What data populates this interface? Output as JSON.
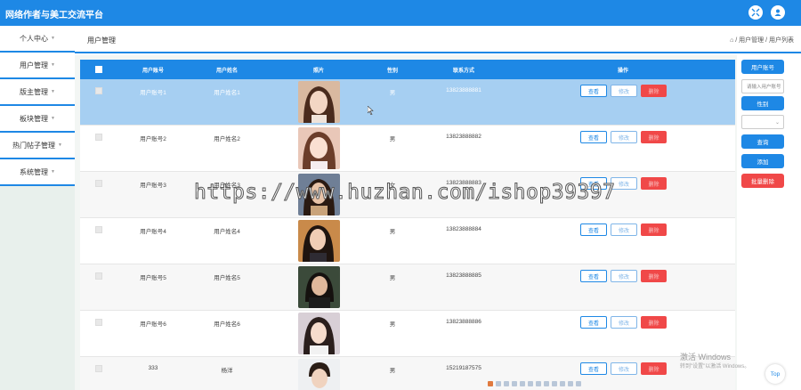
{
  "app": {
    "title": "网络作者与美工交流平台"
  },
  "topbar": {
    "icons": [
      "expand-icon",
      "user-icon"
    ]
  },
  "sidebar": {
    "items": [
      {
        "label": "个人中心"
      },
      {
        "label": "用户管理"
      },
      {
        "label": "版主管理"
      },
      {
        "label": "板块管理"
      },
      {
        "label": "热门帖子管理"
      },
      {
        "label": "系统管理"
      }
    ]
  },
  "header": {
    "page_title": "用户管理",
    "breadcrumb": "⌂ / 用户管理 / 用户列表"
  },
  "table": {
    "headers": [
      "用户账号",
      "用户姓名",
      "照片",
      "性别",
      "联系方式",
      "操作"
    ],
    "rows": [
      {
        "account": "用户账号1",
        "name": "用户姓名1",
        "gender": "男",
        "phone": "13823888881"
      },
      {
        "account": "用户账号2",
        "name": "用户姓名2",
        "gender": "男",
        "phone": "13823888882"
      },
      {
        "account": "用户账号3",
        "name": "用户姓名3",
        "gender": "女",
        "phone": "13823888883"
      },
      {
        "account": "用户账号4",
        "name": "用户姓名4",
        "gender": "男",
        "phone": "13823888884"
      },
      {
        "account": "用户账号5",
        "name": "用户姓名5",
        "gender": "男",
        "phone": "13823888885"
      },
      {
        "account": "用户账号6",
        "name": "用户姓名6",
        "gender": "男",
        "phone": "13823888886"
      },
      {
        "account": "333",
        "name": "杨洋",
        "gender": "男",
        "phone": "15219187575"
      }
    ],
    "actions": {
      "view": "查看",
      "edit": "修改",
      "delete": "删除"
    }
  },
  "right_panel": {
    "account_label": "用户账号",
    "account_placeholder": "请输入用户账号",
    "gender_label": "性别",
    "search_label": "查询",
    "add_label": "添加",
    "batch_delete_label": "批量删除"
  },
  "overlay": {
    "watermark": "https://www.huzhan.com/ishop39397",
    "activate_title": "激活 Windows",
    "activate_sub": "转到\"设置\"以激活 Windows。",
    "top_button": "Top"
  },
  "colors": {
    "primary": "#1e88e5",
    "danger": "#f04848",
    "selected_row": "#a6cff2"
  }
}
